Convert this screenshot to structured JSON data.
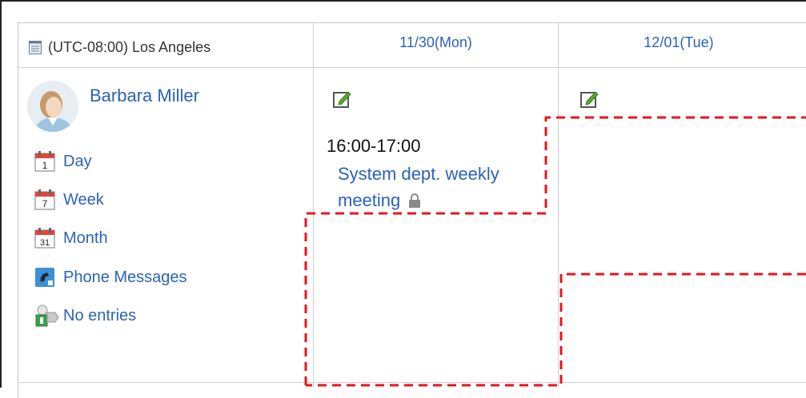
{
  "timezone": {
    "label": "(UTC-08:00) Los Angeles",
    "icon": "calendar-list-icon"
  },
  "columns": [
    {
      "date_label": "11/30(Mon)"
    },
    {
      "date_label": "12/01(Tue)"
    }
  ],
  "user": {
    "name": "Barbara Miller",
    "avatar_icon": "user-avatar"
  },
  "menu": [
    {
      "label": "Day",
      "icon": "calendar-day-icon",
      "icon_text": "1"
    },
    {
      "label": "Week",
      "icon": "calendar-week-icon",
      "icon_text": "7"
    },
    {
      "label": "Month",
      "icon": "calendar-month-icon",
      "icon_text": "31"
    },
    {
      "label": "Phone Messages",
      "icon": "phone-icon"
    },
    {
      "label": "No entries",
      "icon": "presence-icon"
    }
  ],
  "events": [
    {
      "time": "16:00-17:00",
      "title": "System dept. weekly meeting",
      "private": true
    }
  ],
  "colors": {
    "link": "#2b63b5",
    "highlight_dash": "#e8141e",
    "calendar_red": "#e0463c"
  }
}
